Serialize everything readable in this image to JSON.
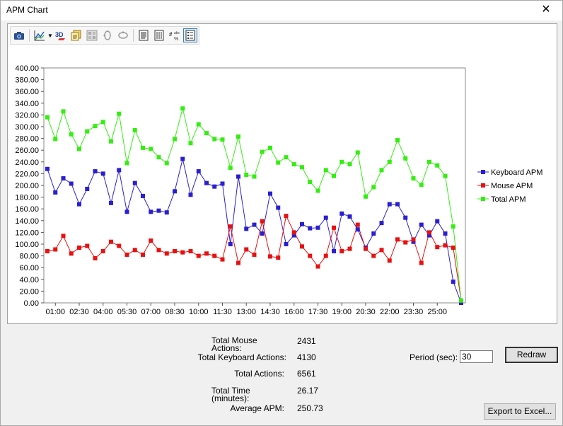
{
  "window": {
    "title": "APM Chart",
    "close_glyph": "✕"
  },
  "toolbar": {
    "icons": [
      "camera-icon",
      "chart-type-icon",
      "3d-icon",
      "copy-icon",
      "palette-icon",
      "rotate-horizontal-icon",
      "rotate-vertical-icon",
      "data-editor-icon",
      "series-editor-icon",
      "number-format-icon",
      "legend-icon"
    ]
  },
  "chart_data": {
    "type": "line",
    "ylim": [
      0,
      400
    ],
    "ytick_labels": [
      "0.00",
      "20.00",
      "40.00",
      "60.00",
      "80.00",
      "100.00",
      "120.00",
      "140.00",
      "160.00",
      "180.00",
      "200.00",
      "220.00",
      "240.00",
      "260.00",
      "280.00",
      "300.00",
      "320.00",
      "340.00",
      "360.00",
      "380.00",
      "400.00"
    ],
    "xtick_labels": [
      "01:00",
      "02:30",
      "04:00",
      "05:30",
      "07:00",
      "08:30",
      "10:00",
      "11:30",
      "13:00",
      "14:30",
      "16:00",
      "17:30",
      "19:00",
      "20:30",
      "22:00",
      "23:30",
      "25:00"
    ],
    "legend_position": "right",
    "series": [
      {
        "name": "Keyboard APM",
        "color": "#2a1fd0",
        "values": [
          228,
          188,
          212,
          203,
          168,
          194,
          224,
          220,
          170,
          226,
          155,
          204,
          182,
          155,
          157,
          154,
          190,
          245,
          184,
          224,
          204,
          198,
          203,
          100,
          215,
          126,
          133,
          118,
          186,
          162,
          100,
          115,
          134,
          127,
          128,
          145,
          88,
          152,
          147,
          125,
          94,
          118,
          136,
          168,
          168,
          145,
          104,
          133,
          115,
          139,
          118,
          36,
          0
        ]
      },
      {
        "name": "Mouse APM",
        "color": "#e81010",
        "values": [
          88,
          91,
          114,
          84,
          94,
          97,
          76,
          88,
          104,
          97,
          82,
          90,
          82,
          106,
          90,
          84,
          88,
          86,
          88,
          80,
          84,
          80,
          74,
          130,
          68,
          91,
          82,
          139,
          79,
          77,
          148,
          120,
          96,
          80,
          62,
          80,
          128,
          88,
          92,
          133,
          92,
          80,
          90,
          72,
          108,
          103,
          108,
          68,
          120,
          95,
          98,
          94,
          4
        ]
      },
      {
        "name": "Total APM",
        "color": "#33ee10",
        "values": [
          316,
          279,
          326,
          287,
          262,
          292,
          301,
          308,
          275,
          322,
          238,
          294,
          264,
          262,
          248,
          238,
          279,
          331,
          272,
          304,
          289,
          279,
          278,
          230,
          283,
          218,
          215,
          257,
          264,
          239,
          248,
          236,
          231,
          206,
          191,
          226,
          216,
          240,
          236,
          256,
          181,
          197,
          226,
          240,
          277,
          246,
          212,
          201,
          240,
          234,
          216,
          130,
          4
        ]
      }
    ]
  },
  "stats": {
    "total_mouse_label": "Total Mouse\nActions:",
    "total_mouse_value": "2431",
    "total_keyboard_label": "Total Keyboard Actions:",
    "total_keyboard_value": "4130",
    "total_actions_label": "Total Actions:",
    "total_actions_value": "6561",
    "total_time_label": "Total Time\n(minutes):",
    "total_time_value": "26.17",
    "average_apm_label": "Average APM:",
    "average_apm_value": "250.73"
  },
  "controls": {
    "period_label": "Period (sec):",
    "period_value": "30",
    "redraw_label": "Redraw",
    "export_label": "Export to Excel..."
  }
}
